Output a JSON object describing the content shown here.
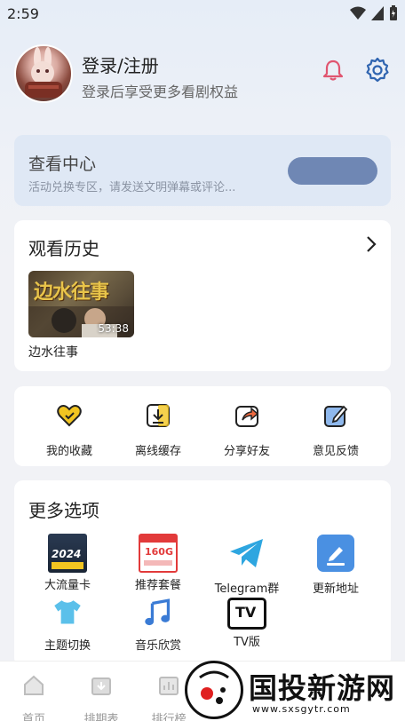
{
  "status": {
    "time": "2:59"
  },
  "profile": {
    "title": "登录/注册",
    "subtitle": "登录后享受更多看剧权益"
  },
  "center": {
    "title": "查看中心",
    "subtitle": "活动兑换专区，请发送文明弹幕或评论..."
  },
  "history": {
    "title": "观看历史",
    "item": {
      "thumb_title": "边水往事",
      "duration": "53:38",
      "name": "边水往事"
    }
  },
  "actions": [
    {
      "label": "我的收藏",
      "icon": "favorite-heart-icon"
    },
    {
      "label": "离线缓存",
      "icon": "download-icon"
    },
    {
      "label": "分享好友",
      "icon": "share-icon"
    },
    {
      "label": "意见反馈",
      "icon": "feedback-edit-icon"
    }
  ],
  "more": {
    "title": "更多选项",
    "options": [
      {
        "label": "大流量卡",
        "icon": "sim-card-promo-icon",
        "art": "2024"
      },
      {
        "label": "推荐套餐",
        "icon": "data-plan-icon",
        "art": "160G"
      },
      {
        "label": "Telegram群",
        "icon": "telegram-icon"
      },
      {
        "label": "更新地址",
        "icon": "update-address-icon"
      },
      {
        "label": "主题切换",
        "icon": "tshirt-theme-icon"
      },
      {
        "label": "音乐欣赏",
        "icon": "music-note-icon"
      },
      {
        "label": "TV版",
        "icon": "tv-icon",
        "art": "TV"
      }
    ]
  },
  "tabs": [
    {
      "label": "首页",
      "icon": "home-icon"
    },
    {
      "label": "排期表",
      "icon": "calendar-icon"
    },
    {
      "label": "排行榜",
      "icon": "ranking-icon"
    }
  ],
  "watermark": {
    "text": "国投新游网",
    "url": "www.sxsgytr.com"
  },
  "colors": {
    "accent": "#3b82c4",
    "center_button": "#6f87b4",
    "favorite": "#e7b91f"
  }
}
